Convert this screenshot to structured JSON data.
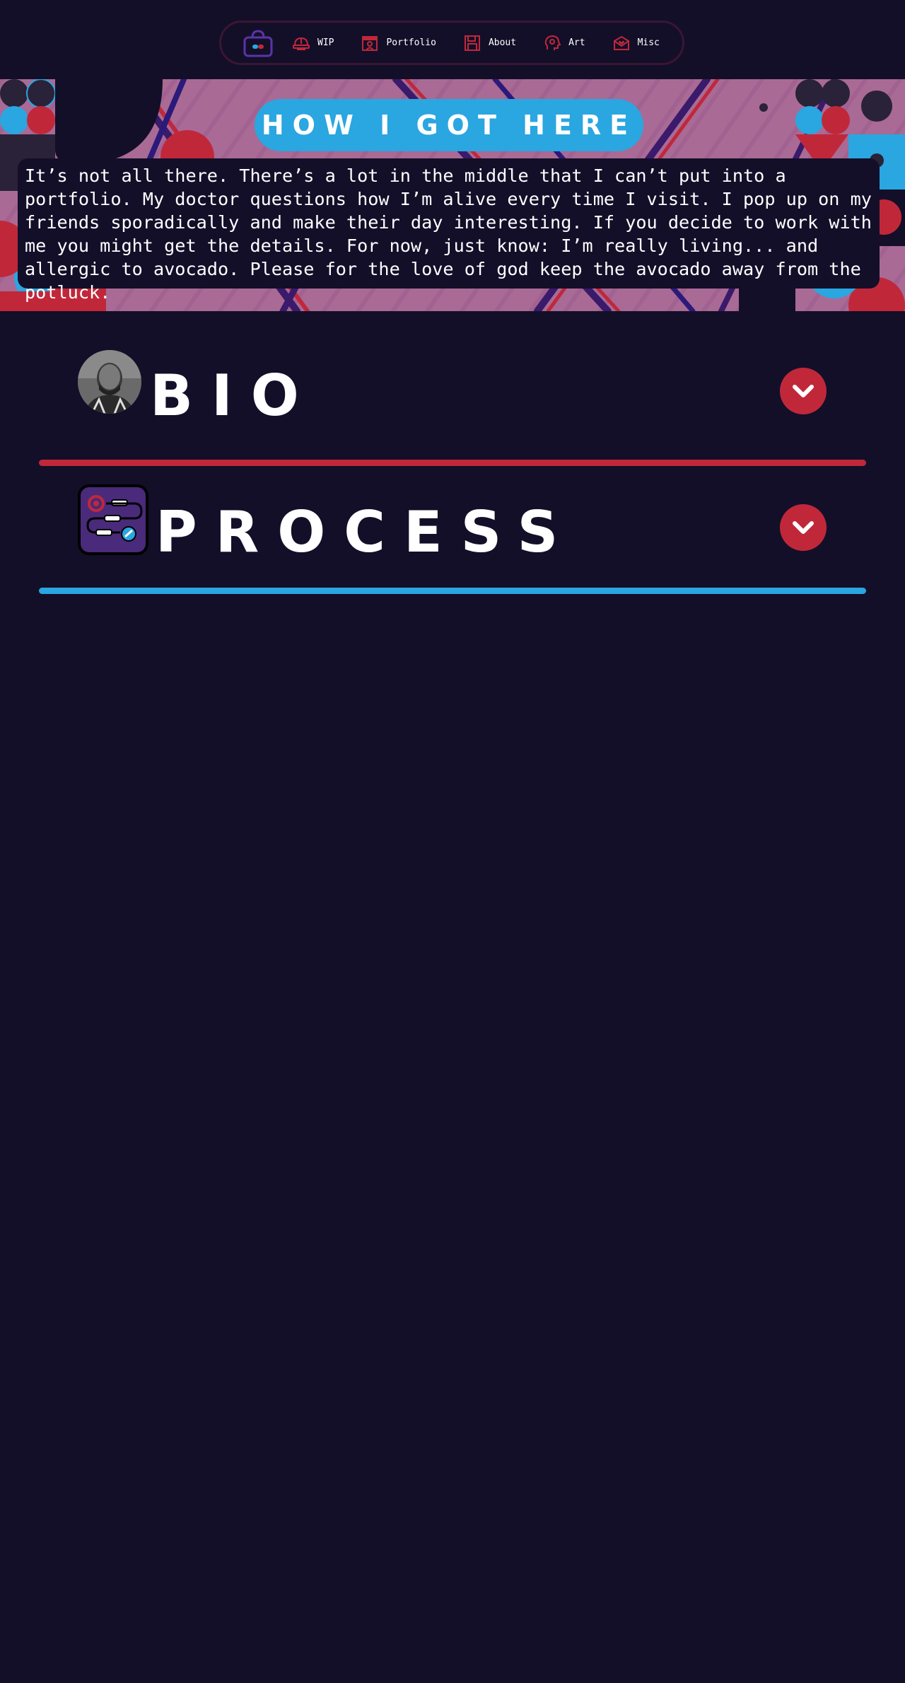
{
  "nav": {
    "items": [
      {
        "label": "WIP",
        "icon": "hardhat-icon"
      },
      {
        "label": "Portfolio",
        "icon": "storefront-icon"
      },
      {
        "label": "About",
        "icon": "floppy-disk-icon"
      },
      {
        "label": "Art",
        "icon": "head-gear-icon"
      },
      {
        "label": "Misc",
        "icon": "envelope-heart-icon"
      }
    ],
    "logo_icon": "bag-icon"
  },
  "hero": {
    "title": "How I got here",
    "text": "It’s not all there. There’s a lot in the middle that I can’t put into a portfolio. My doctor questions how I’m alive every time I visit. I pop up on my friends sporadically and make their day interesting. If you decide to work with me you might get the details. For now, just know: I’m really living... and allergic to avocado. Please for the love of god keep the avocado away from the potluck."
  },
  "sections": [
    {
      "title": "Bio",
      "icon": "avatar-photo",
      "toggle_icon": "chevron-down-icon",
      "divider_color": "#c0283a"
    },
    {
      "title": "Process",
      "icon": "process-flow-icon",
      "toggle_icon": "chevron-down-icon",
      "divider_color": "#2aa6e0"
    }
  ],
  "colors": {
    "background": "#130f29",
    "accent_red": "#c0283a",
    "accent_blue": "#2aa6e0",
    "hero_pink": "#a96a96",
    "icon_purple": "#4a2a7a"
  }
}
